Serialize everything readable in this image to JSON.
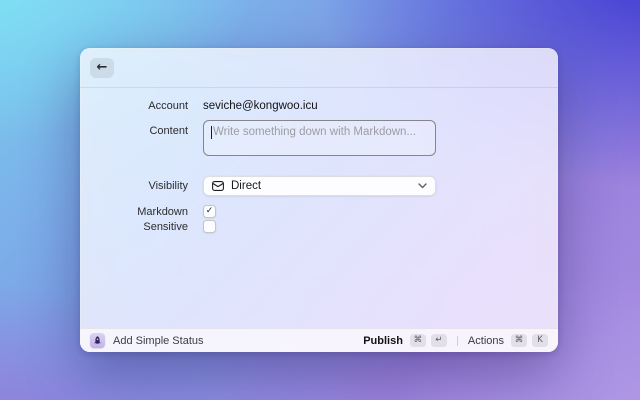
{
  "window": {
    "header": {
      "back_glyph": "←"
    },
    "form": {
      "account": {
        "label": "Account",
        "value": "seviche@kongwoo.icu"
      },
      "content": {
        "label": "Content",
        "placeholder": "Write something down with Markdown..."
      },
      "visibility": {
        "label": "Visibility",
        "value": "Direct",
        "icon": "envelope-icon"
      },
      "markdown": {
        "label": "Markdown",
        "checked": true,
        "check_glyph": "✓"
      },
      "sensitive": {
        "label": "Sensitive",
        "checked": false
      }
    },
    "footer": {
      "app_title": "Add Simple Status",
      "publish": {
        "label": "Publish",
        "keys": [
          "⌘",
          "↵"
        ]
      },
      "actions": {
        "label": "Actions",
        "keys": [
          "⌘",
          "K"
        ]
      }
    }
  },
  "colors": {
    "bg_top_left": "#80e2f5",
    "bg_top_right": "#3e38d2",
    "bg_bottom_left": "#9778d8",
    "bg_bottom_right": "#b19ae6",
    "window_tint": "#faf9fc"
  }
}
